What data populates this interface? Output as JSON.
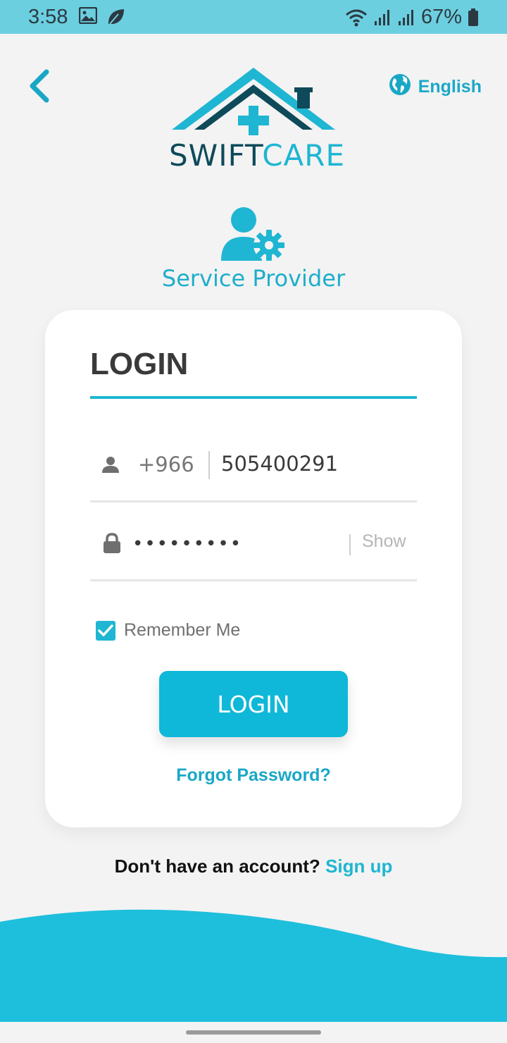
{
  "status_bar": {
    "time": "3:58",
    "battery": "67%",
    "icons": [
      "image-icon",
      "leaf-icon",
      "wifi-icon",
      "signal-icon",
      "signal-icon",
      "battery-icon"
    ]
  },
  "header": {
    "back_icon": "chevron-left-icon",
    "language_icon": "globe-icon",
    "language_label": "English"
  },
  "logo": {
    "text_bold": "SWIFT",
    "text_light": "CARE"
  },
  "role": {
    "icon": "user-gear-icon",
    "label": "Service Provider"
  },
  "login_card": {
    "title": "LOGIN",
    "phone": {
      "icon": "user-icon",
      "country_code": "+966",
      "value": "505400291"
    },
    "password": {
      "icon": "lock-icon",
      "value": "•••••••••",
      "show_label": "Show"
    },
    "remember_me": {
      "label": "Remember Me",
      "checked": true
    },
    "login_button": "LOGIN",
    "forgot_password": "Forgot Password?"
  },
  "signup": {
    "prompt": "Don't have an account?",
    "link": "Sign up"
  },
  "colors": {
    "accent": "#1eb6d2",
    "dark_teal": "#0e4a5a",
    "status_bar": "#6ccfe0",
    "background": "#f3f3f3"
  }
}
